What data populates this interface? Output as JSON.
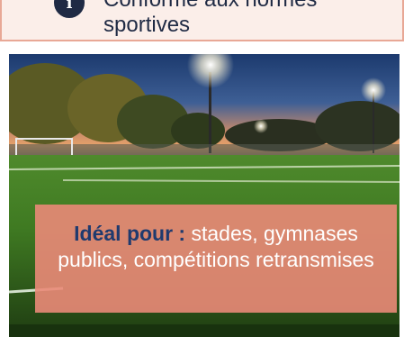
{
  "feature": {
    "icon": "info-icon",
    "icon_glyph": "i",
    "text": "Conforme aux normes sportives"
  },
  "photo": {
    "subject": "stadium-field-image"
  },
  "caption": {
    "label": "Idéal pour :",
    "text": " stades, gymnases publics, compétitions retransmises"
  },
  "colors": {
    "navy": "#1f2a44",
    "salmon": "#ea8a78",
    "card_bg": "#fbeee9"
  }
}
